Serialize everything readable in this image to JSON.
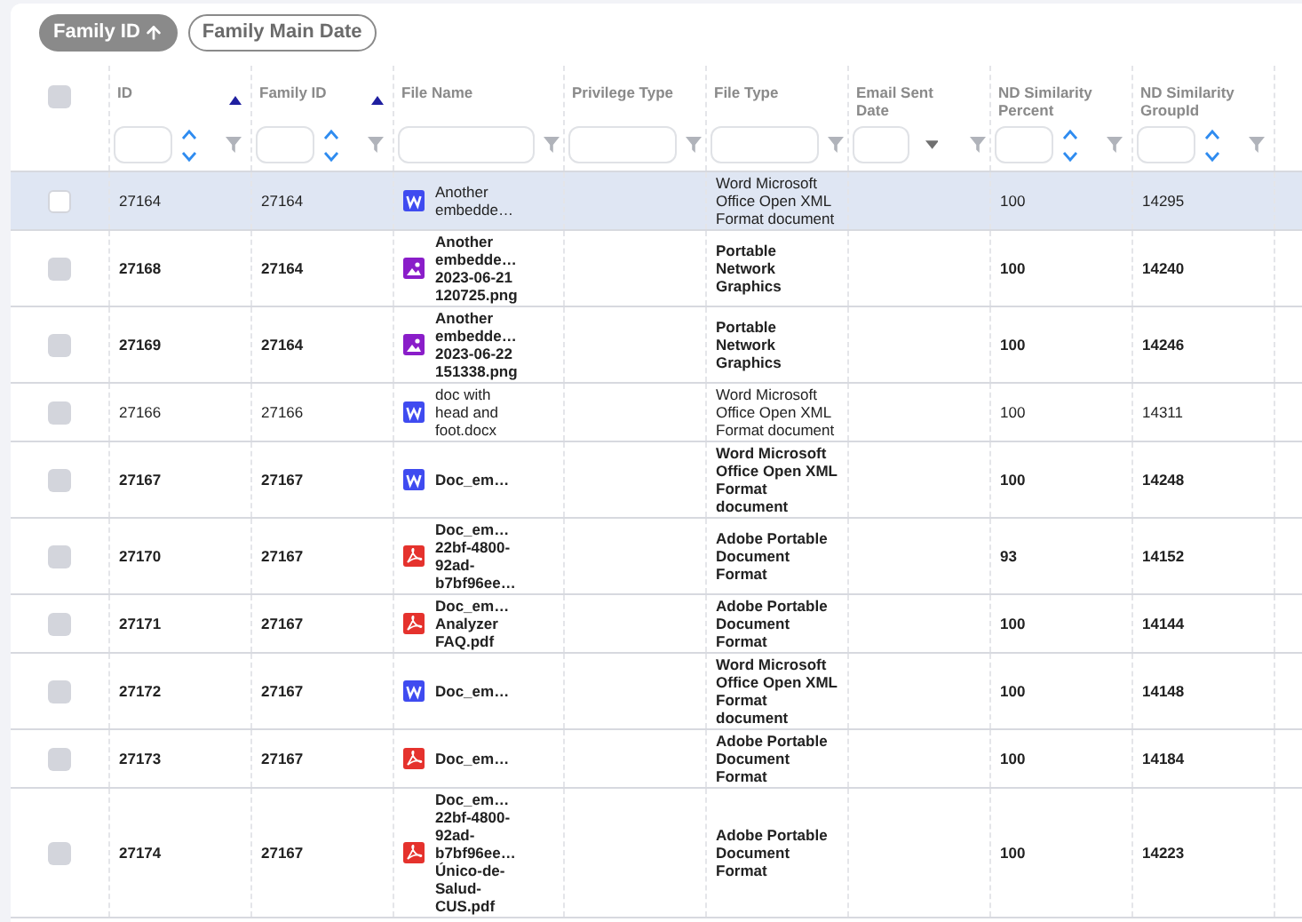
{
  "sort_chips": [
    {
      "label": "Family ID",
      "active": true
    },
    {
      "label": "Family Main Date",
      "active": false
    }
  ],
  "header_checkbox": {
    "checked": false
  },
  "columns": [
    {
      "label": "ID",
      "kind": "number",
      "sorted": true
    },
    {
      "label": "Family ID",
      "kind": "number",
      "sorted": true
    },
    {
      "label": "File Name",
      "kind": "text",
      "sorted": false
    },
    {
      "label": "Privilege Type",
      "kind": "text",
      "sorted": false
    },
    {
      "label": "File Type",
      "kind": "text",
      "sorted": false
    },
    {
      "label": "Email Sent Date",
      "kind": "date",
      "sorted": false
    },
    {
      "label": "ND Similarity Percent",
      "kind": "number",
      "sorted": false
    },
    {
      "label": "ND Similarity GroupId",
      "kind": "number",
      "sorted": false
    }
  ],
  "rows": [
    {
      "selected": true,
      "bold": false,
      "id": "27164",
      "family_id": "27164",
      "kind": "word",
      "file_name": "Another\nembedde…",
      "file_type": "Word Microsoft\nOffice Open XML\nFormat document",
      "percent": "100",
      "group_id": "14295"
    },
    {
      "selected": false,
      "bold": true,
      "id": "27168",
      "family_id": "27164",
      "kind": "image",
      "file_name": "Another\nembedde…\n2023-06-21\n120725.png",
      "file_type": "Portable Network\nGraphics",
      "percent": "100",
      "group_id": "14240"
    },
    {
      "selected": false,
      "bold": true,
      "id": "27169",
      "family_id": "27164",
      "kind": "image",
      "file_name": "Another\nembedde…\n2023-06-22\n151338.png",
      "file_type": "Portable Network\nGraphics",
      "percent": "100",
      "group_id": "14246"
    },
    {
      "selected": false,
      "bold": false,
      "id": "27166",
      "family_id": "27166",
      "kind": "word",
      "file_name": "doc with\nhead and\nfoot.docx",
      "file_type": "Word Microsoft\nOffice Open XML\nFormat document",
      "percent": "100",
      "group_id": "14311"
    },
    {
      "selected": false,
      "bold": true,
      "id": "27167",
      "family_id": "27167",
      "kind": "word",
      "file_name": "Doc_em…",
      "file_type": "Word Microsoft\nOffice Open XML\nFormat\ndocument",
      "percent": "100",
      "group_id": "14248"
    },
    {
      "selected": false,
      "bold": true,
      "id": "27170",
      "family_id": "27167",
      "kind": "pdf",
      "file_name": "Doc_em…\n22bf-4800-\n92ad-\nb7bf96ee…",
      "file_type": "Adobe Portable\nDocument\nFormat",
      "percent": "93",
      "group_id": "14152"
    },
    {
      "selected": false,
      "bold": true,
      "id": "27171",
      "family_id": "27167",
      "kind": "pdf",
      "file_name": "Doc_em…\nAnalyzer\nFAQ.pdf",
      "file_type": "Adobe Portable\nDocument\nFormat",
      "percent": "100",
      "group_id": "14144"
    },
    {
      "selected": false,
      "bold": true,
      "id": "27172",
      "family_id": "27167",
      "kind": "word",
      "file_name": "Doc_em…",
      "file_type": "Word Microsoft\nOffice Open XML\nFormat\ndocument",
      "percent": "100",
      "group_id": "14148"
    },
    {
      "selected": false,
      "bold": true,
      "id": "27173",
      "family_id": "27167",
      "kind": "pdf",
      "file_name": "Doc_em…",
      "file_type": "Adobe Portable\nDocument\nFormat",
      "percent": "100",
      "group_id": "14184"
    },
    {
      "selected": false,
      "bold": true,
      "id": "27174",
      "family_id": "27167",
      "kind": "pdf",
      "file_name": "Doc_em…\n22bf-4800-\n92ad-\nb7bf96ee…\nÚnico-de-\nSalud-\nCUS.pdf",
      "file_type": "Adobe Portable\nDocument\nFormat",
      "percent": "100",
      "group_id": "14223"
    }
  ]
}
